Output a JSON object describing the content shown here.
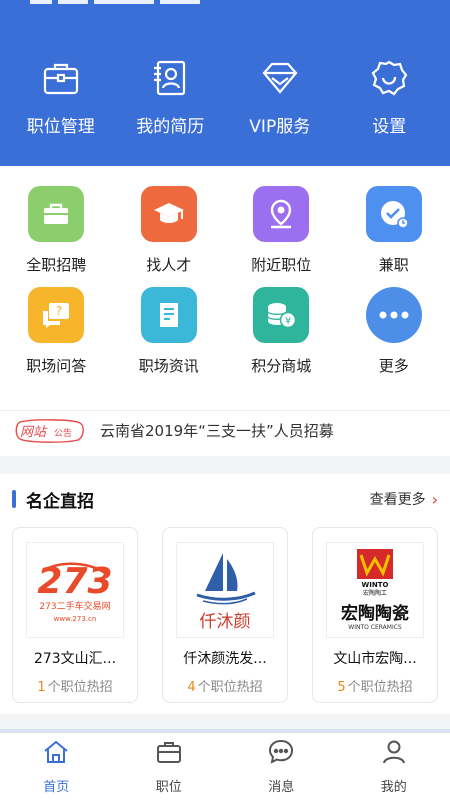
{
  "header": {
    "quick_actions": [
      {
        "label": "职位管理",
        "icon": "briefcase-icon"
      },
      {
        "label": "我的简历",
        "icon": "resume-icon"
      },
      {
        "label": "VIP服务",
        "icon": "diamond-icon"
      },
      {
        "label": "设置",
        "icon": "gear-icon"
      }
    ],
    "color": "#3b6fd8"
  },
  "grid": [
    {
      "label": "全职招聘",
      "icon": "briefcase-icon",
      "color": "#8ccd6e"
    },
    {
      "label": "找人才",
      "icon": "graduation-cap-icon",
      "color": "#ee6a3e"
    },
    {
      "label": "附近职位",
      "icon": "location-pin-icon",
      "color": "#9b6ff0"
    },
    {
      "label": "兼职",
      "icon": "clock-check-icon",
      "color": "#4d90f0"
    },
    {
      "label": "职场问答",
      "icon": "question-chat-icon",
      "color": "#f7b52b"
    },
    {
      "label": "职场资讯",
      "icon": "document-icon",
      "color": "#3bb8d9"
    },
    {
      "label": "积分商城",
      "icon": "coins-icon",
      "color": "#2fb59c"
    },
    {
      "label": "更多",
      "icon": "more-dots-icon",
      "color": "#4d8fe8"
    }
  ],
  "notice": {
    "badge_main": "网站",
    "badge_sub": "公告",
    "text": "云南省2019年“三支一扶”人员招募"
  },
  "companies": {
    "title": "名企直招",
    "more": "查看更多",
    "jobs_suffix": "个职位热招",
    "items": [
      {
        "name": "273文山汇...",
        "jobs": "1",
        "logo_text": "273二手车交易网",
        "logo_sub": "www.273.cn"
      },
      {
        "name": "仟沐颜洗发...",
        "jobs": "4",
        "logo_text": "仟沐颜"
      },
      {
        "name": "文山市宏陶...",
        "jobs": "5",
        "logo_text": "宏陶陶瓷",
        "logo_sub": "WINTO CERAMICS",
        "logo_mark": "WINTO",
        "logo_mark_sub": "宏陶陶工"
      }
    ]
  },
  "tabbar": {
    "items": [
      {
        "label": "首页",
        "icon": "home-icon",
        "active": true
      },
      {
        "label": "职位",
        "icon": "briefcase-icon",
        "active": false
      },
      {
        "label": "消息",
        "icon": "message-icon",
        "active": false
      },
      {
        "label": "我的",
        "icon": "user-icon",
        "active": false
      }
    ]
  }
}
